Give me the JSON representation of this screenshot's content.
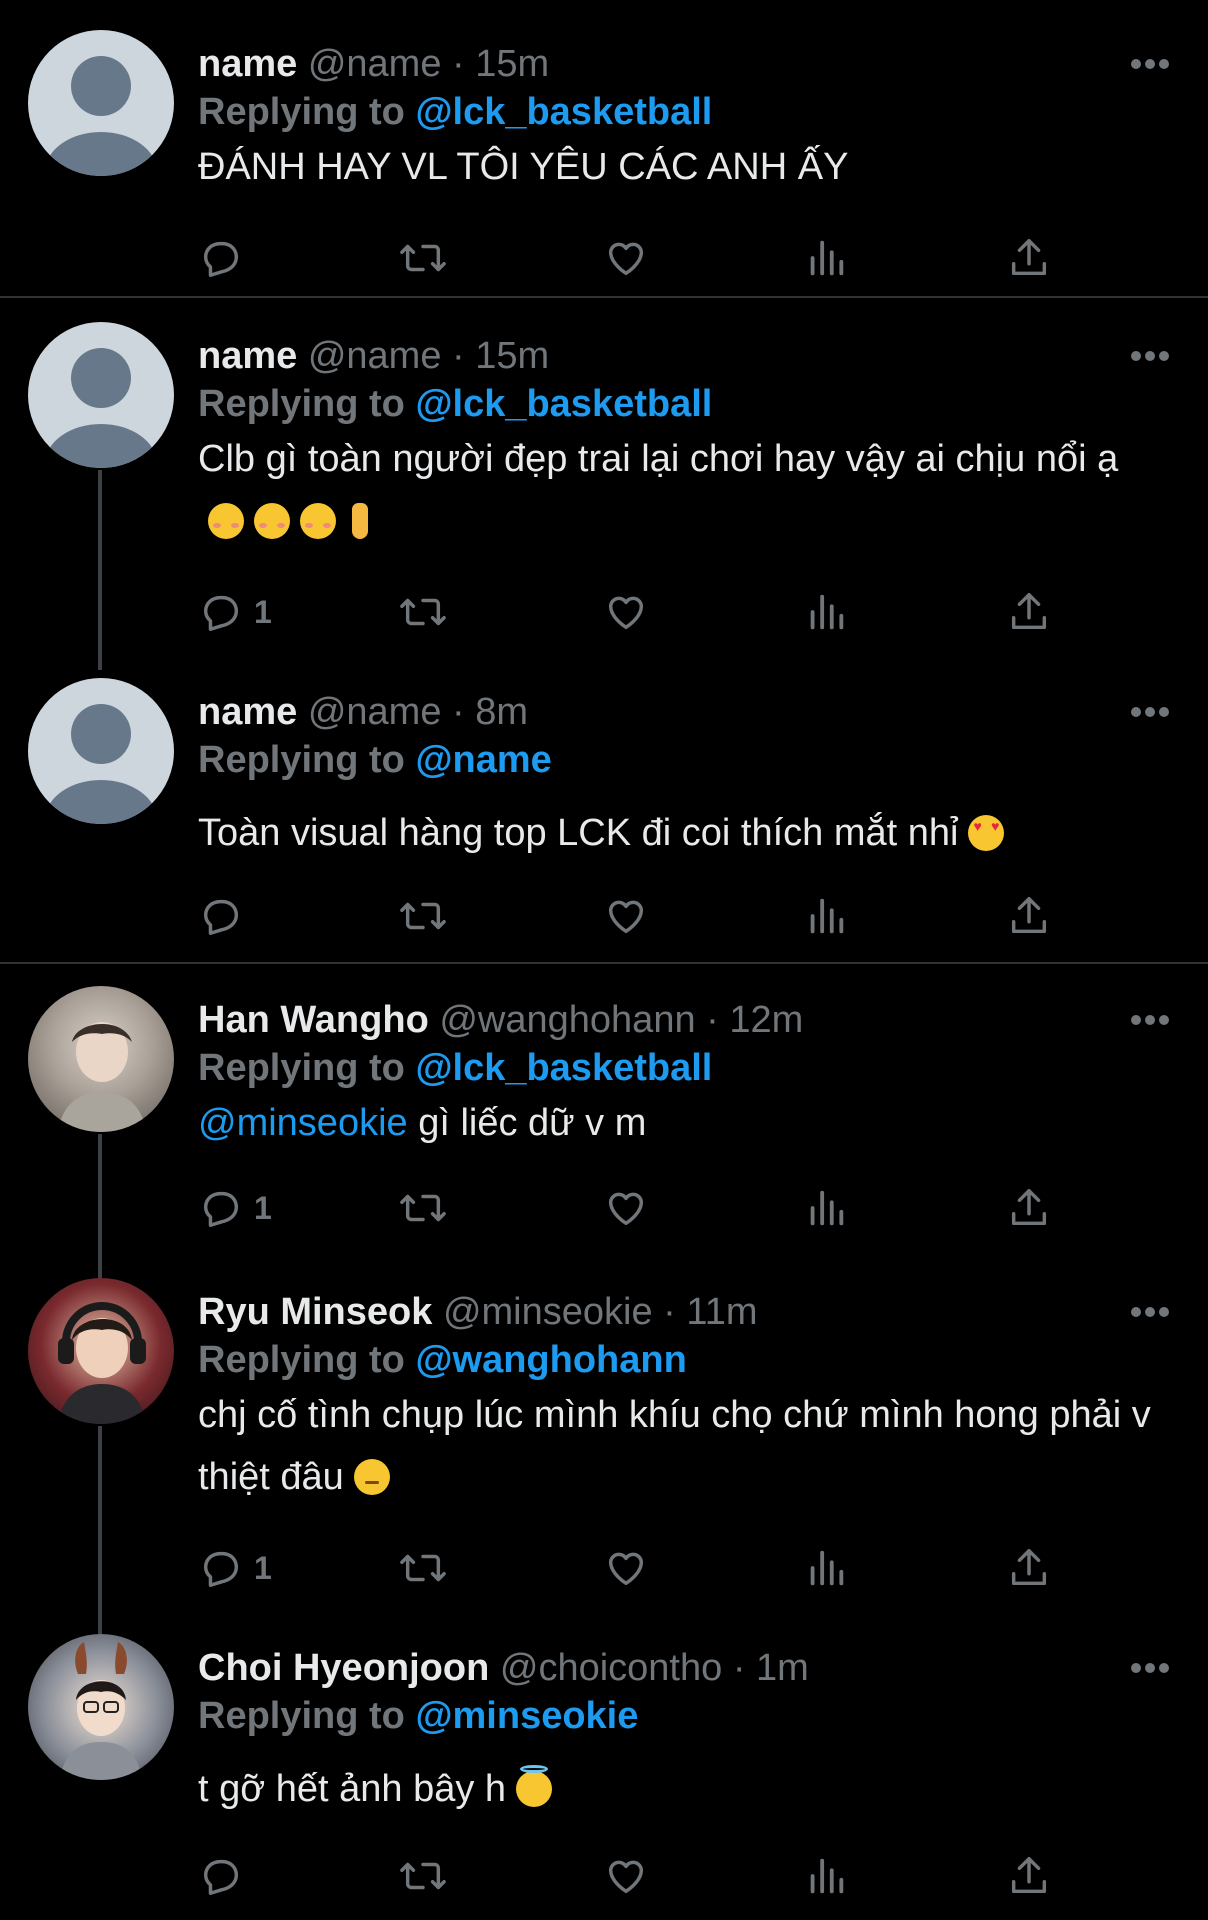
{
  "colors": {
    "background": "#000000",
    "text": "#e7e9ea",
    "muted": "#71767b",
    "accent": "#1d9bf0",
    "divider": "#2f3336"
  },
  "reply_prefix": "Replying to",
  "icons": {
    "reply": "reply-icon",
    "retweet": "retweet-icon",
    "like": "heart-icon",
    "views": "analytics-icon",
    "share": "share-icon",
    "more": "more-icon"
  },
  "tweets": [
    {
      "name": "name",
      "handle": "@name",
      "time": "15m",
      "sep": "·",
      "replying_to": "@lck_basketball",
      "text": "ĐÁNH HAY VL TÔI YÊU CÁC ANH ẤY",
      "reply_count": ""
    },
    {
      "name": "name",
      "handle": "@name",
      "time": "15m",
      "sep": "·",
      "replying_to": "@lck_basketball",
      "text": "Clb gì toàn người đẹp trai lại chơi hay vậy ai chịu nổi ạ",
      "emojis": [
        "smiling-face",
        "smiling-face",
        "smiling-face",
        "pinching-hand"
      ],
      "reply_count": "1"
    },
    {
      "name": "name",
      "handle": "@name",
      "time": "8m",
      "sep": "·",
      "replying_to": "@name",
      "text": "Toàn visual hàng top LCK đi coi thích mắt nhỉ",
      "emojis": [
        "heart-eyes"
      ],
      "reply_count": ""
    },
    {
      "name": "Han Wangho",
      "handle": "@wanghohann",
      "time": "12m",
      "sep": "·",
      "replying_to": "@lck_basketball",
      "mention": "@minseokie",
      "text": " gì liếc dữ v m",
      "reply_count": "1"
    },
    {
      "name": "Ryu Minseok",
      "handle": "@minseokie",
      "time": "11m",
      "sep": "·",
      "replying_to": "@wanghohann",
      "text": "chj cố tình chụp lúc mình khíu chọ chứ mình hong phải v thiệt đâu",
      "emojis": [
        "pensive"
      ],
      "reply_count": "1"
    },
    {
      "name": "Choi Hyeonjoon",
      "handle": "@choicontho",
      "time": "1m",
      "sep": "·",
      "replying_to": "@minseokie",
      "text": "t gỡ hết ảnh bây h",
      "emojis": [
        "halo"
      ],
      "reply_count": ""
    }
  ]
}
